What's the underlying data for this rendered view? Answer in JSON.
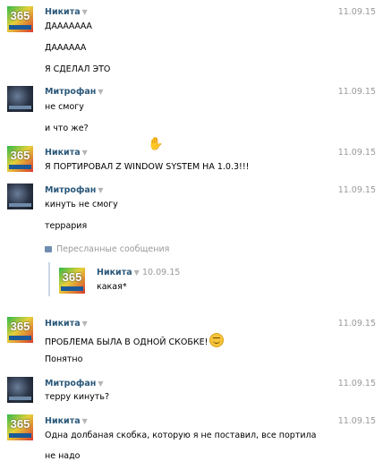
{
  "messages": [
    {
      "author": "Никита",
      "date": "11.09.15",
      "avatar": "365",
      "lines": [
        "ДААААААА",
        "ДАААААА",
        "Я СДЕЛАЛ ЭТО"
      ]
    },
    {
      "author": "Митрофан",
      "date": "11.09.15",
      "avatar": "dark",
      "lines": [
        "не смогу",
        "и что же?"
      ]
    },
    {
      "author": "Никита",
      "date": "11.09.15",
      "avatar": "365",
      "lines": [
        "Я ПОРТИРОВАЛ Z WINDOW SYSTEM НА 1.0.3!!!"
      ]
    },
    {
      "author": "Митрофан",
      "date": "11.09.15",
      "avatar": "dark",
      "lines": [
        "кинуть не смогу",
        "террария"
      ]
    },
    {
      "author": "Никита",
      "date": "11.09.15",
      "avatar": "365",
      "lines": [
        "ПРОБЛЕМА БЫЛА В ОДНОЙ СКОБКЕ!",
        "Понятно"
      ]
    },
    {
      "author": "Митрофан",
      "date": "11.09.15",
      "avatar": "dark",
      "lines": [
        "терру кинуть?"
      ]
    },
    {
      "author": "Никита",
      "date": "11.09.15",
      "avatar": "365",
      "lines": [
        "Одна долбаная скобка, которую я не поставил, все портила",
        "не надо"
      ]
    }
  ],
  "forwarded": {
    "label": "Пересланные сообщения",
    "author": "Никита",
    "date": "10.09.15",
    "avatar": "365",
    "text": "какая*"
  },
  "avatar_text": "365",
  "icons": {
    "caret": "caret-down-icon",
    "forward": "forward-icon",
    "emoji": "smile-emoji-icon",
    "cursor": "hand-cursor-icon"
  }
}
